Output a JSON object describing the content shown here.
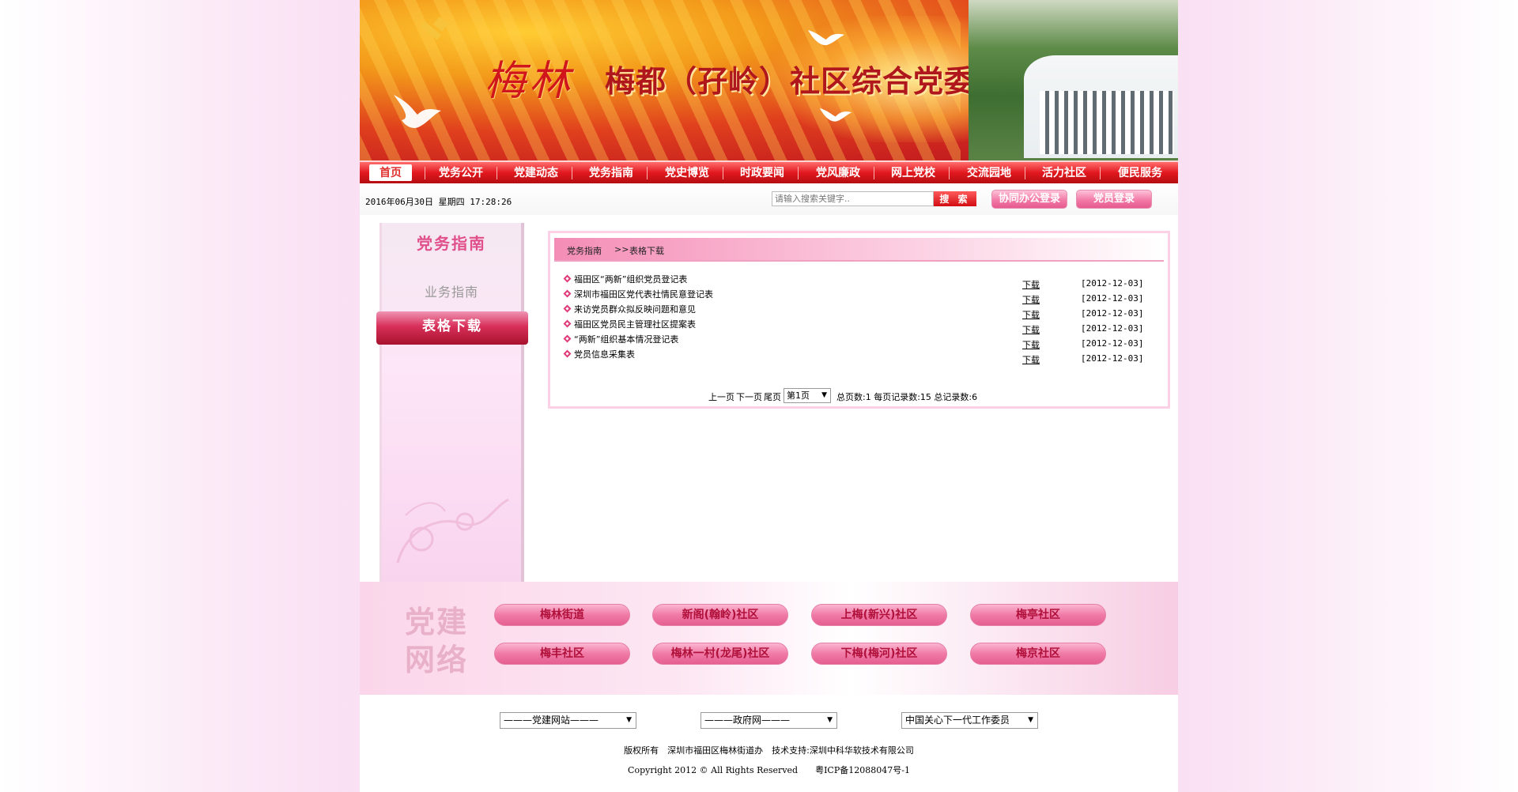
{
  "banner": {
    "title_script": "梅林",
    "title_main": "梅都（孖岭）社区综合党委"
  },
  "nav": {
    "items": [
      "首页",
      "党务公开",
      "党建动态",
      "党务指南",
      "党史博览",
      "时政要闻",
      "党风廉政",
      "网上党校",
      "交流园地",
      "活力社区",
      "便民服务"
    ]
  },
  "toolbar": {
    "datetime": "2016年06月30日 星期四 17:28:26",
    "search_placeholder": "请输入搜索关键字..",
    "search_button": "搜 索",
    "office_login": "协同办公登录",
    "member_login": "党员登录"
  },
  "sidebar": {
    "title": "党务指南",
    "items": [
      "业务指南",
      "表格下载"
    ]
  },
  "content": {
    "breadcrumb_parent": "党务指南",
    "breadcrumb_sep": ">>",
    "breadcrumb_current": "表格下载",
    "files": [
      {
        "name": "福田区“两新”组织党员登记表",
        "link": "下载",
        "date": "[2012-12-03]"
      },
      {
        "name": "深圳市福田区党代表社情民意登记表",
        "link": "下载",
        "date": "[2012-12-03]"
      },
      {
        "name": "来访党员群众拟反映问题和意见",
        "link": "下载",
        "date": "[2012-12-03]"
      },
      {
        "name": "福田区党员民主管理社区提案表",
        "link": "下载",
        "date": "[2012-12-03]"
      },
      {
        "name": "“两新”组织基本情况登记表",
        "link": "下载",
        "date": "[2012-12-03]"
      },
      {
        "name": "党员信息采集表",
        "link": "下载",
        "date": "[2012-12-03]"
      }
    ],
    "pager": {
      "prev": "上一页",
      "next": "下一页",
      "last": "尾页",
      "page_select": "第1页",
      "summary": "总页数:1 每页记录数:15 总记录数:6"
    }
  },
  "network": {
    "label_line1": "党建",
    "label_line2": "网络",
    "links": [
      "梅林街道",
      "新阁(翰岭)社区",
      "上梅(新兴)社区",
      "梅亭社区",
      "梅丰社区",
      "梅林一村(龙尾)社区",
      "下梅(梅河)社区",
      "梅京社区"
    ]
  },
  "footer": {
    "selects": [
      "———党建网站———",
      "———政府网———",
      "中国关心下一代工作委员"
    ],
    "copyright": "版权所有　深圳市福田区梅林街道办　技术支持:深圳中科华软技术有限公司",
    "copyright_en": "Copyright 2012 © All Rights Reserved　　粤ICP备12088047号-1"
  },
  "colors": {
    "nav_red": "#e2181e",
    "accent_pink": "#f07aa6",
    "title_red": "#d0161c"
  }
}
